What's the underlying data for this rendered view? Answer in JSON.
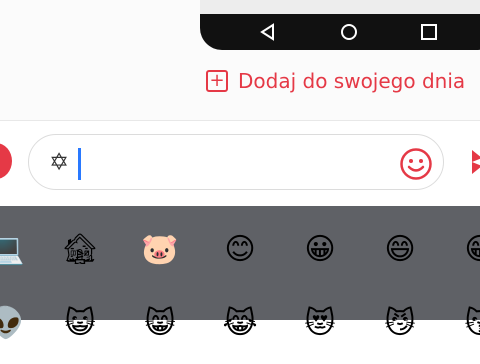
{
  "add_link": {
    "label": "Dodaj do swojego dnia",
    "icon": "plus-square-icon"
  },
  "input": {
    "value": "✡"
  },
  "keyboard": {
    "row1": [
      "💻",
      "🏚",
      "🐷",
      "😊",
      "😀",
      "😄",
      "😁"
    ],
    "row2": [
      "👽",
      "😺",
      "😸",
      "😹",
      "😻",
      "😼",
      "😽"
    ]
  },
  "colors": {
    "accent": "#e53946",
    "caret": "#2979ff",
    "keyboard_bg": "#5f6166"
  }
}
